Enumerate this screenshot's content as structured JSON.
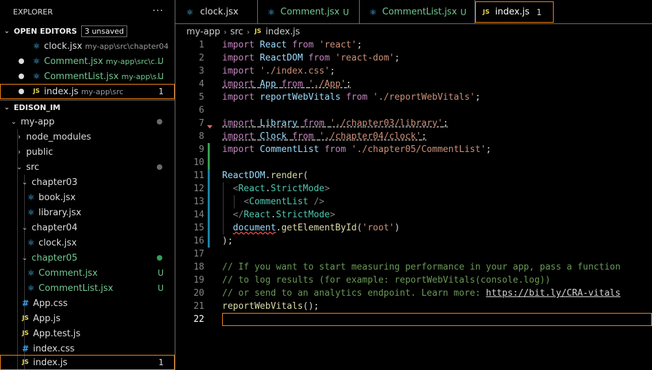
{
  "explorer": {
    "title": "EXPLORER",
    "more": "···",
    "open_editors": {
      "label": "OPEN EDITORS",
      "badge": "3 unsaved",
      "items": [
        {
          "name": "clock.jsx",
          "path": "my-app\\src\\chapter04",
          "status": ""
        },
        {
          "name": "Comment.jsx",
          "path": "my-app\\src\\c...",
          "status": "U"
        },
        {
          "name": "CommentList.jsx",
          "path": "my-app\\s...",
          "status": "U"
        },
        {
          "name": "index.js",
          "path": "my-app\\src",
          "status": "1"
        }
      ]
    },
    "workspace": {
      "label": "EDISON_IM",
      "tree": [
        {
          "label": "my-app"
        },
        {
          "label": "node_modules"
        },
        {
          "label": "public"
        },
        {
          "label": "src"
        },
        {
          "label": "chapter03"
        },
        {
          "label": "book.jsx"
        },
        {
          "label": "library.jsx"
        },
        {
          "label": "chapter04"
        },
        {
          "label": "clock.jsx"
        },
        {
          "label": "chapter05"
        },
        {
          "label": "Comment.jsx",
          "status": "U"
        },
        {
          "label": "CommentList.jsx",
          "status": "U"
        },
        {
          "label": "App.css"
        },
        {
          "label": "App.js"
        },
        {
          "label": "App.test.js"
        },
        {
          "label": "index.css"
        },
        {
          "label": "index.js",
          "status": "1"
        }
      ]
    }
  },
  "tabs": [
    {
      "label": "clock.jsx",
      "status": ""
    },
    {
      "label": "Comment.jsx",
      "status": "U"
    },
    {
      "label": "CommentList.jsx",
      "status": "U"
    },
    {
      "label": "index.js",
      "status": "1"
    }
  ],
  "breadcrumb": [
    "my-app",
    "src",
    "index.js"
  ],
  "icons": {
    "react": "⚛",
    "js": "JS",
    "css": "#",
    "chevron_down": "⌄",
    "chevron_right": "›"
  },
  "editor": {
    "line_numbers": [
      "1",
      "2",
      "3",
      "4",
      "5",
      "6",
      "7",
      "8",
      "9",
      "10",
      "11",
      "12",
      "13",
      "14",
      "15",
      "16",
      "17",
      "18",
      "19",
      "20",
      "21",
      "22"
    ],
    "lines": [
      [
        [
          "k",
          "import"
        ],
        [
          "p",
          " "
        ],
        [
          "v",
          "React"
        ],
        [
          "p",
          " "
        ],
        [
          "k",
          "from"
        ],
        [
          "p",
          " "
        ],
        [
          "s",
          "'react'"
        ],
        [
          "p",
          ";"
        ]
      ],
      [
        [
          "k",
          "import"
        ],
        [
          "p",
          " "
        ],
        [
          "v",
          "ReactDOM"
        ],
        [
          "p",
          " "
        ],
        [
          "k",
          "from"
        ],
        [
          "p",
          " "
        ],
        [
          "s",
          "'react-dom'"
        ],
        [
          "p",
          ";"
        ]
      ],
      [
        [
          "k",
          "import"
        ],
        [
          "p",
          " "
        ],
        [
          "s",
          "'./index.css'"
        ],
        [
          "p",
          ";"
        ]
      ],
      [
        [
          "k dash",
          "import"
        ],
        [
          "p dash",
          " "
        ],
        [
          "v dash",
          "App"
        ],
        [
          "p dash",
          " "
        ],
        [
          "k dash",
          "from"
        ],
        [
          "p dash",
          " "
        ],
        [
          "s dash",
          "'./App'"
        ],
        [
          "p dash",
          ";"
        ]
      ],
      [
        [
          "k",
          "import"
        ],
        [
          "p",
          " "
        ],
        [
          "v",
          "reportWebVitals"
        ],
        [
          "p",
          " "
        ],
        [
          "k",
          "from"
        ],
        [
          "p",
          " "
        ],
        [
          "s",
          "'./reportWebVitals'"
        ],
        [
          "p",
          ";"
        ]
      ],
      [],
      [
        [
          "k dash",
          "import"
        ],
        [
          "p dash",
          " "
        ],
        [
          "v dash",
          "Library"
        ],
        [
          "p dash",
          " "
        ],
        [
          "k dash",
          "from"
        ],
        [
          "p dash",
          " "
        ],
        [
          "s dash",
          "'./chapter03/library'"
        ],
        [
          "p dash",
          ";"
        ]
      ],
      [
        [
          "k dash",
          "import"
        ],
        [
          "p dash",
          " "
        ],
        [
          "v dash",
          "Clock"
        ],
        [
          "p dash",
          " "
        ],
        [
          "k dash",
          "from"
        ],
        [
          "p dash",
          " "
        ],
        [
          "s dash",
          "'./chapter04/clock'"
        ],
        [
          "p dash",
          ";"
        ]
      ],
      [
        [
          "k",
          "import"
        ],
        [
          "p",
          " "
        ],
        [
          "v",
          "CommentList"
        ],
        [
          "p",
          " "
        ],
        [
          "k",
          "from"
        ],
        [
          "p",
          " "
        ],
        [
          "s",
          "'./chapter05/CommentList'"
        ],
        [
          "p",
          ";"
        ]
      ],
      [],
      [
        [
          "v",
          "ReactDOM"
        ],
        [
          "p",
          "."
        ],
        [
          "fn",
          "render"
        ],
        [
          "p",
          "("
        ]
      ],
      [
        [
          "p",
          "  "
        ],
        [
          "tg",
          "<"
        ],
        [
          "t",
          "React"
        ],
        [
          "p",
          "."
        ],
        [
          "t",
          "StrictMode"
        ],
        [
          "tg",
          ">"
        ]
      ],
      [
        [
          "p",
          "    "
        ],
        [
          "tg",
          "<"
        ],
        [
          "t",
          "CommentList"
        ],
        [
          "p",
          " "
        ],
        [
          "tg",
          "/>"
        ]
      ],
      [
        [
          "p",
          "  "
        ],
        [
          "tg",
          "</"
        ],
        [
          "t",
          "React"
        ],
        [
          "p",
          "."
        ],
        [
          "t",
          "StrictMode"
        ],
        [
          "tg",
          ">"
        ]
      ],
      [
        [
          "p",
          "  "
        ],
        [
          "v squig",
          "document"
        ],
        [
          "p",
          "."
        ],
        [
          "fn",
          "getElementById"
        ],
        [
          "p",
          "("
        ],
        [
          "s",
          "'root'"
        ],
        [
          "p",
          ")"
        ]
      ],
      [
        [
          "p",
          ");"
        ]
      ],
      [],
      [
        [
          "c",
          "// If you want to start measuring performance in your app, pass a function"
        ]
      ],
      [
        [
          "c",
          "// to log results (for example: reportWebVitals(console.log))"
        ]
      ],
      [
        [
          "c",
          "// or send to an analytics endpoint. Learn more: "
        ],
        [
          "lnk",
          "https://bit.ly/CRA-vitals"
        ]
      ],
      [
        [
          "fn",
          "reportWebVitals"
        ],
        [
          "p",
          "();"
        ]
      ],
      []
    ]
  }
}
